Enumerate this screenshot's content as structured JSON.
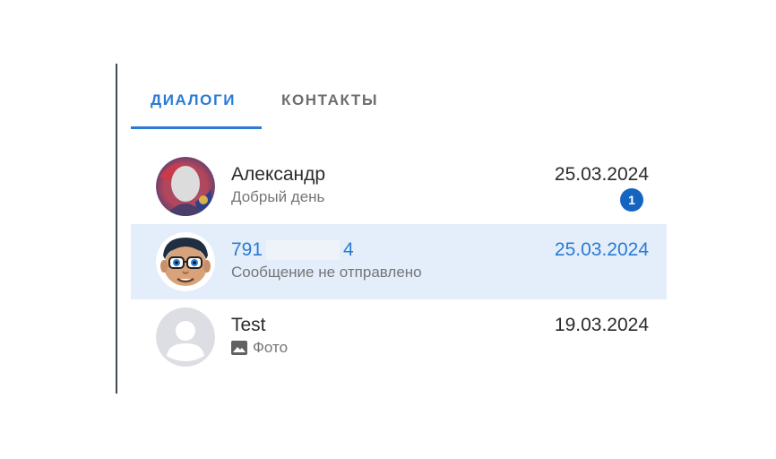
{
  "tabs": [
    {
      "label": "ДИАЛОГИ",
      "active": true
    },
    {
      "label": "КОНТАКТЫ",
      "active": false
    }
  ],
  "dialogs": [
    {
      "name": "Александр",
      "preview": "Добрый день",
      "date": "25.03.2024",
      "unread": "1",
      "selected": false,
      "avatar": "photo-avatar"
    },
    {
      "name_prefix": "791",
      "name_suffix": "4",
      "preview": "Сообщение не отправлено",
      "date": "25.03.2024",
      "selected": true,
      "avatar": "cartoon-avatar"
    },
    {
      "name": "Test",
      "preview": "Фото",
      "preview_icon": "image-icon",
      "date": "19.03.2024",
      "selected": false,
      "avatar": "default-user-avatar"
    }
  ],
  "colors": {
    "accent": "#2a7ad6",
    "selected_bg": "#e3eefa",
    "badge": "#1565c0",
    "text": "#2b2b2b",
    "muted": "#757575"
  }
}
